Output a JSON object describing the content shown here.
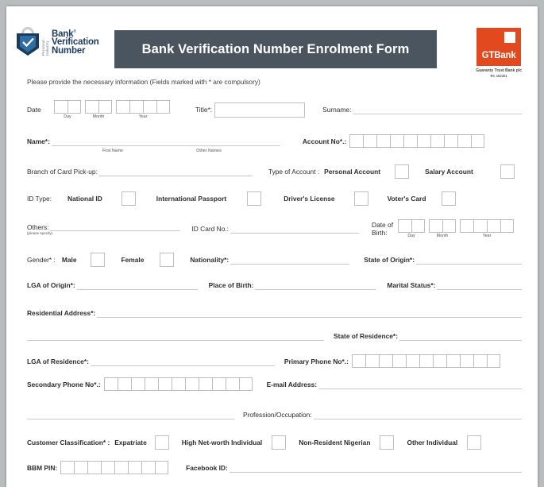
{
  "header": {
    "logo_line1": "Bank",
    "logo_line2": "Verification",
    "logo_line3": "Number",
    "logo_vertical": "Personal . Industry",
    "title": "Bank Verification Number Enrolment Form",
    "bank_name": "GTBank",
    "bank_legal_name": "Guaranty Trust Bank plc",
    "bank_rc": "RC 152321"
  },
  "instruction": "Please provide the necessary information (Fields marked with * are compulsory)",
  "labels": {
    "date": "Date",
    "day": "Day",
    "month": "Month",
    "year": "Year",
    "title": "Title*:",
    "surname": "Surname:",
    "name": "Name*:",
    "first_name": "First Name",
    "other_names": "Other Names",
    "account_no": "Account No*.:",
    "branch_pickup": "Branch of Card Pick-up:",
    "type_of_account": "Type of Account :",
    "personal_account": "Personal Account",
    "salary_account": "Salary Account",
    "id_type": "ID Type:",
    "national_id": "National ID",
    "international_passport": "International Passport",
    "drivers_license": "Driver's License",
    "voters_card": "Voter's Card",
    "others": "Others:",
    "please_specify": "(please specify)",
    "id_card_no": "ID Card No.:",
    "date_of_birth_l1": "Date of",
    "date_of_birth_l2": "Birth:",
    "gender": "Gender* :",
    "male": "Male",
    "female": "Female",
    "nationality": "Nationality*:",
    "state_of_origin": "State of Origin*:",
    "lga_of_origin": "LGA of Origin*:",
    "place_of_birth": "Place of Birth:",
    "marital_status": "Marital Status*:",
    "residential_address": "Residential Address*:",
    "state_of_residence": "State of Residence*:",
    "lga_of_residence": "LGA of Residence*:",
    "primary_phone": "Primary Phone No*.:",
    "secondary_phone": "Secondary Phone No*.:",
    "email_address": "E-mail Address:",
    "profession": "Profession/Occupation:",
    "customer_classification": "Customer Classification* :",
    "expatriate": "Expatriate",
    "high_net_worth": "High Net-worth  Individual",
    "non_resident_nigerian": "Non-Resident Nigerian",
    "other_individual": "Other Individual",
    "bbm_pin": "BBM PIN:",
    "facebook_id": "Facebook ID:"
  },
  "box_counts": {
    "date_day": 2,
    "date_month": 2,
    "date_year": 4,
    "account_no": 10,
    "dob_day": 2,
    "dob_month": 2,
    "dob_year": 4,
    "primary_phone": 11,
    "secondary_phone": 11,
    "bbm_pin": 8
  },
  "values": {
    "title": "",
    "surname": "",
    "name": "",
    "branch_pickup": "",
    "others": "",
    "id_card_no": "",
    "nationality": "",
    "state_of_origin": "",
    "lga_of_origin": "",
    "place_of_birth": "",
    "marital_status": "",
    "residential_address_1": "",
    "residential_address_2": "",
    "state_of_residence": "",
    "lga_of_residence": "",
    "email_address": "",
    "profession": "",
    "facebook_id": ""
  },
  "colors": {
    "banner": "#4b5560",
    "brand_orange": "#e2491e",
    "shield_dark": "#1b3a5c",
    "line": "#c6c8cb",
    "page_bg": "#b9bcbd"
  }
}
